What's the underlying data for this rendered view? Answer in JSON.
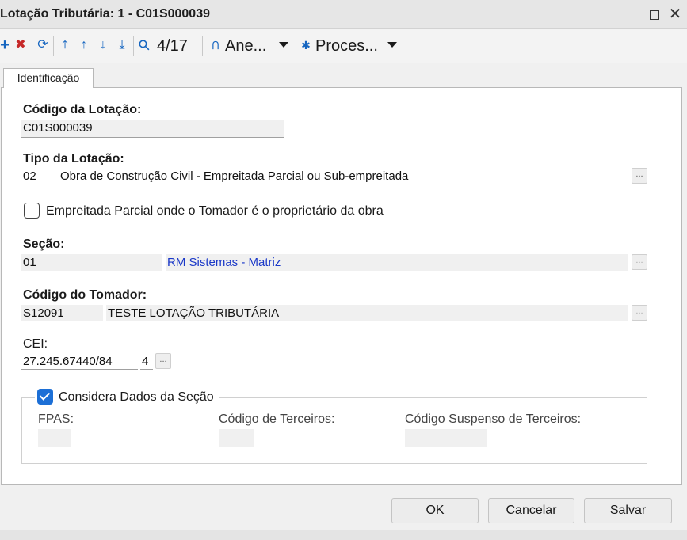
{
  "window": {
    "title": "Lotação Tributária: 1 - C01S000039",
    "close_glyph": "✕"
  },
  "toolbar": {
    "add_glyph": "+",
    "delete_glyph": "✖",
    "refresh_glyph": "⟳",
    "first_glyph": "⤒",
    "prev_glyph": "↑",
    "next_glyph": "↓",
    "last_glyph": "⤓",
    "search_glyph": "⚲",
    "record_position": "4/17",
    "attach_glyph": "⊂",
    "attachments_label": "Ane...",
    "process_glyph": "✱",
    "processes_label": "Proces..."
  },
  "tabs": [
    {
      "label": "Identificação"
    }
  ],
  "form": {
    "codigo_lotacao": {
      "label": "Código da Lotação:",
      "value": "C01S000039"
    },
    "tipo_lotacao": {
      "label": "Tipo da Lotação:",
      "code": "02",
      "description": "Obra de Construção Civil - Empreitada Parcial ou Sub-empreitada"
    },
    "empreitada_parcial": {
      "label": "Empreitada Parcial onde o Tomador é o proprietário da obra",
      "checked": false
    },
    "secao": {
      "label": "Seção:",
      "code": "01",
      "description": "RM Sistemas - Matriz"
    },
    "codigo_tomador": {
      "label": "Código do Tomador:",
      "code": "S12091",
      "description": "TESTE LOTAÇÃO TRIBUTÁRIA"
    },
    "cei": {
      "label": "CEI:",
      "value": "27.245.67440/84",
      "digit": "4"
    },
    "considera_dados_secao": {
      "label": "Considera Dados da Seção",
      "checked": true
    },
    "fpas": {
      "label": "FPAS:",
      "value": ""
    },
    "codigo_terceiros": {
      "label": "Código de Terceiros:",
      "value": ""
    },
    "codigo_suspenso_terceiros": {
      "label": "Código Suspenso de Terceiros:",
      "value": ""
    },
    "lookup_glyph": "..."
  },
  "buttons": {
    "ok": "OK",
    "cancel": "Cancelar",
    "save": "Salvar"
  },
  "colors": {
    "accent": "#1c6fd6",
    "delete_red": "#c62828",
    "toolbar_blue": "#1565c0",
    "link_blue": "#1a38c8"
  }
}
